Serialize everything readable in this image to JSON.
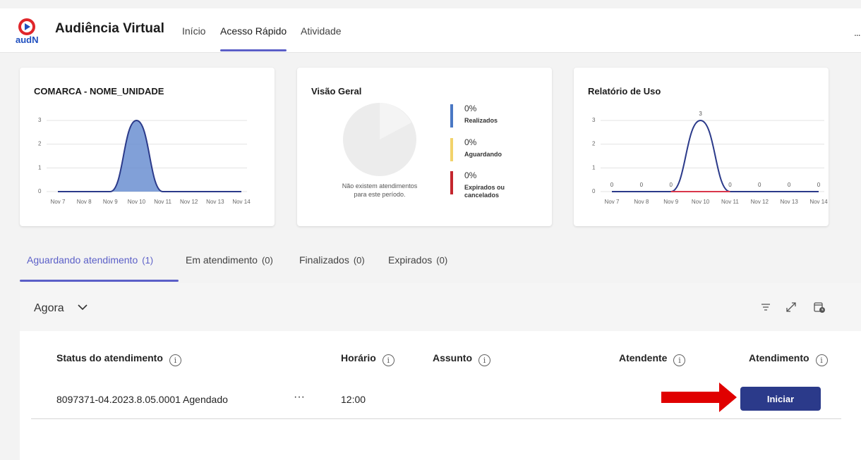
{
  "app": {
    "title": "Audiência Virtual",
    "logo_text": "audN",
    "nav_tabs": [
      {
        "label": "Início",
        "active": false
      },
      {
        "label": "Acesso Rápido",
        "active": true
      },
      {
        "label": "Atividade",
        "active": false
      }
    ],
    "more_label": "..."
  },
  "cards": {
    "unit": {
      "title": "COMARCA - NOME_UNIDADE",
      "chart_data": {
        "type": "area",
        "title": "COMARCA - NOME_UNIDADE",
        "categories": [
          "Nov 7",
          "Nov 8",
          "Nov 9",
          "Nov 10",
          "Nov 11",
          "Nov 12",
          "Nov 13",
          "Nov 14"
        ],
        "values": [
          0,
          0,
          0,
          3,
          0,
          0,
          0,
          0
        ],
        "y_ticks": [
          "0",
          "1",
          "2",
          "3"
        ],
        "ylim": [
          0,
          3
        ],
        "grid": true,
        "color": "#6b8fd1"
      }
    },
    "overview": {
      "title": "Visão Geral",
      "empty_message_line1": "Não existem atendimentos",
      "empty_message_line2": "para este período.",
      "legend": [
        {
          "value": "0%",
          "label": "Realizados",
          "color": "#4a78c4"
        },
        {
          "value": "0%",
          "label": "Aguardando",
          "color": "#f2d36b"
        },
        {
          "value": "0%",
          "label": "Expirados ou",
          "label2": "cancelados",
          "color": "#c4262e"
        }
      ],
      "chart_data": {
        "type": "pie",
        "title": "Visão Geral",
        "categories": [
          "Realizados",
          "Aguardando",
          "Expirados ou cancelados"
        ],
        "values": [
          0,
          0,
          0
        ]
      }
    },
    "usage": {
      "title": "Relatório de Uso",
      "chart_data": {
        "type": "line",
        "title": "Relatório de Uso",
        "categories": [
          "Nov 7",
          "Nov 8",
          "Nov 9",
          "Nov 10",
          "Nov 11",
          "Nov 12",
          "Nov 13",
          "Nov 14"
        ],
        "series": [
          {
            "values": [
              0,
              0,
              0,
              3,
              0,
              0,
              0,
              0
            ],
            "color": "#2b3a8a"
          },
          {
            "values": [
              0,
              0,
              0,
              0,
              0,
              0,
              0,
              0
            ],
            "color": "#d9364a"
          }
        ],
        "point_labels": [
          "0",
          "0",
          "0",
          "3",
          "0",
          "0",
          "0",
          "0"
        ],
        "y_ticks": [
          "0",
          "1",
          "2",
          "3"
        ],
        "ylim": [
          0,
          3
        ],
        "grid": true
      }
    }
  },
  "status_tabs": [
    {
      "label": "Aguardando atendimento",
      "count": "(1)",
      "active": true
    },
    {
      "label": "Em atendimento",
      "count": "(0)",
      "active": false
    },
    {
      "label": "Finalizados",
      "count": "(0)",
      "active": false
    },
    {
      "label": "Expirados",
      "count": "(0)",
      "active": false
    }
  ],
  "panel": {
    "period": "Agora",
    "columns": [
      "Status do atendimento",
      "Horário",
      "Assunto",
      "Atendente",
      "Atendimento"
    ],
    "info_glyph": "i",
    "rows": [
      {
        "status": "8097371-04.2023.8.05.0001 Agendado",
        "dots": "···",
        "time": "12:00",
        "subject": "",
        "attendant": "",
        "action": "Iniciar"
      }
    ]
  },
  "colors": {
    "accent": "#5b5fc7",
    "primary_button": "#2b3a8a",
    "arrow": "#e00000"
  }
}
